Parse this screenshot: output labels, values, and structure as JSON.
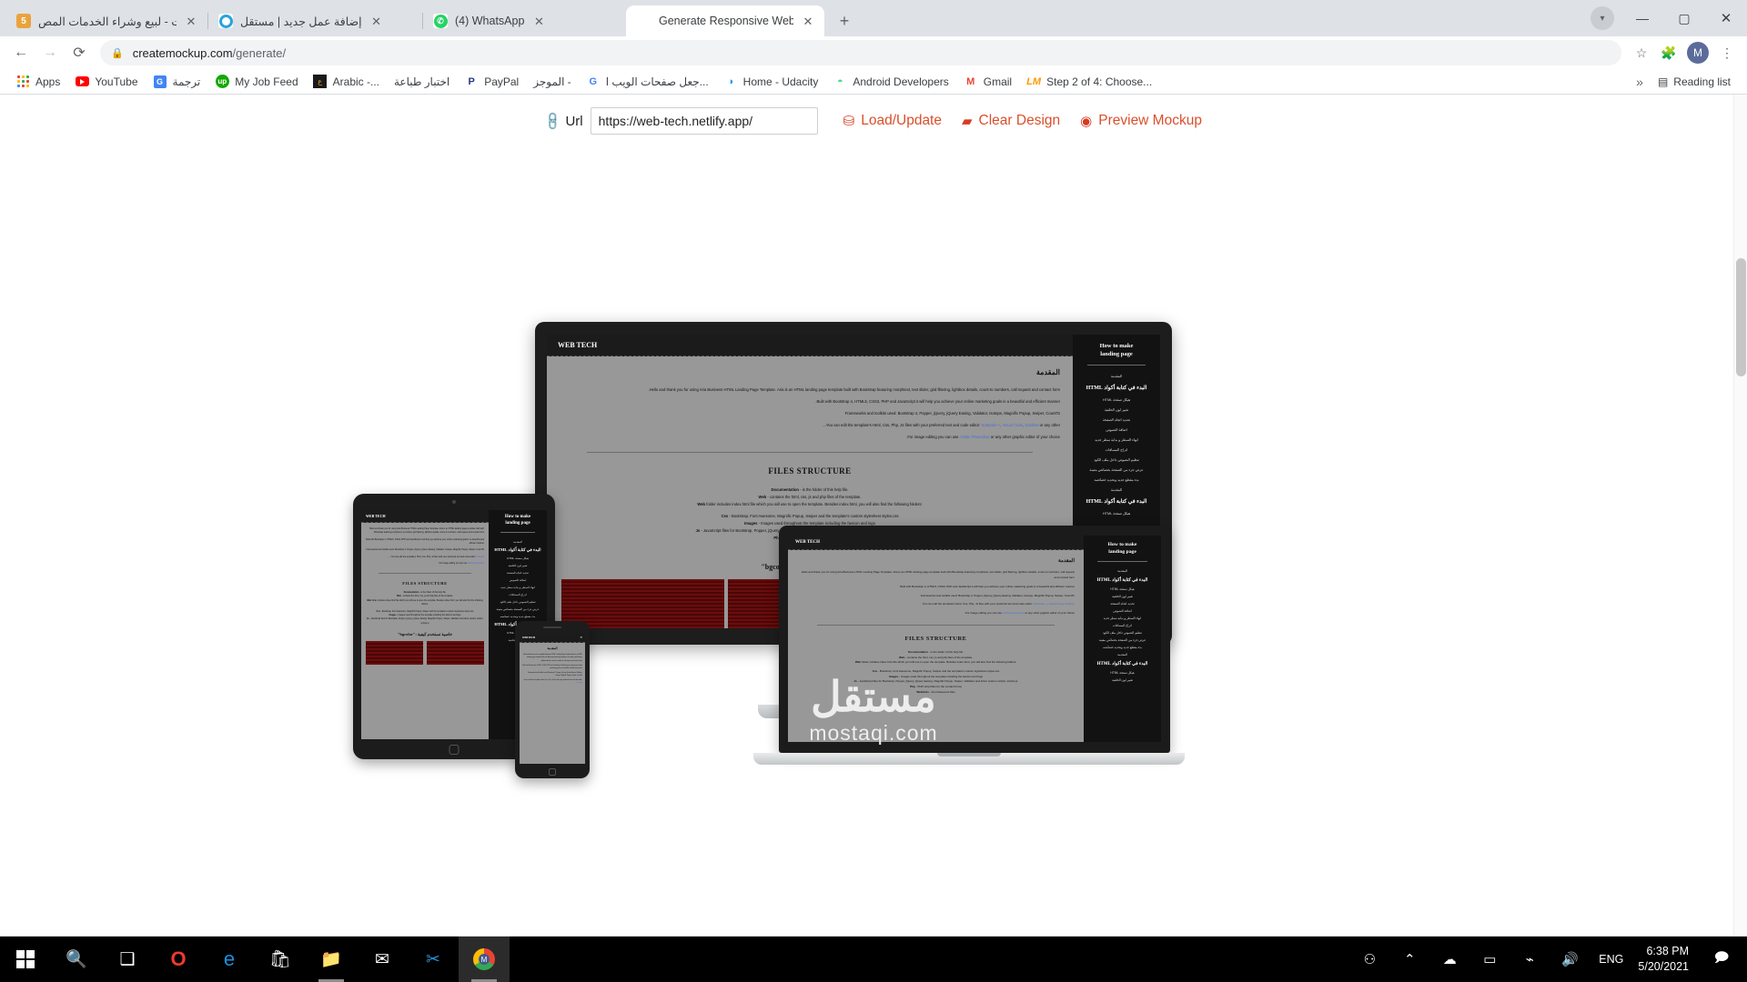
{
  "browser": {
    "tabs": [
      {
        "title": "خمسات - لبيع وشراء الخدمات المص",
        "favicon": "khamsat-icon",
        "active": false,
        "close": "✕"
      },
      {
        "title": "إضافة عمل جديد | مستقل",
        "favicon": "mostaqil-icon",
        "active": false,
        "close": "✕"
      },
      {
        "title": "(4) WhatsApp",
        "favicon": "whatsapp-icon",
        "active": false,
        "close": "✕"
      },
      {
        "title": "Generate Responsive Website Mo",
        "favicon": "laptop-icon",
        "active": true,
        "close": "✕"
      }
    ],
    "new_tab_label": "+",
    "window_controls": {
      "minimize": "—",
      "maximize": "▢",
      "close": "✕",
      "profile": "▾"
    },
    "nav": {
      "back": "←",
      "forward": "→",
      "reload": "⟳"
    },
    "omnibox": {
      "lock": "🔒",
      "url_bold": "createmockup.com",
      "url_dim": "/generate/",
      "star": "☆",
      "extensions": "🧩",
      "avatar_letter": "M",
      "menu": "⋮"
    },
    "bookmarks": [
      {
        "label": "Apps",
        "icon": "apps-grid-icon"
      },
      {
        "label": "YouTube",
        "icon": "youtube-icon"
      },
      {
        "label": "ترجمة",
        "icon": "google-translate-icon"
      },
      {
        "label": "My Job Feed",
        "icon": "upwork-icon"
      },
      {
        "label": "Arabic -...",
        "icon": "arabic-site-icon"
      },
      {
        "label": "اختبار طباعة",
        "icon": "print-test-icon"
      },
      {
        "label": "PayPal",
        "icon": "paypal-icon"
      },
      {
        "label": "الموجز -",
        "icon": "almojaz-icon"
      },
      {
        "label": "جعل صفحات الويب ا...",
        "icon": "google-icon"
      },
      {
        "label": "Home - Udacity",
        "icon": "udacity-icon"
      },
      {
        "label": "Android Developers",
        "icon": "android-icon"
      },
      {
        "label": "Gmail",
        "icon": "gmail-icon"
      },
      {
        "label": "Step 2 of 4: Choose...",
        "icon": "lm-icon"
      }
    ],
    "overflow_label": "»",
    "reading_list": {
      "label": "Reading list",
      "icon": "reading-list-icon"
    }
  },
  "app": {
    "url_label": "Url",
    "url_value": "https://web-tech.netlify.app/",
    "url_placeholder": "https://",
    "actions": [
      {
        "label": "Load/Update",
        "icon": "cloud-upload-icon",
        "color": "#d94f2b"
      },
      {
        "label": "Clear Design",
        "icon": "eraser-icon",
        "color": "#d94f2b"
      },
      {
        "label": "Preview Mockup",
        "icon": "eye-icon",
        "color": "#d94f2b"
      }
    ],
    "accent_color": "#d94f2b"
  },
  "mockup": {
    "site_title": "WEB TECH",
    "heading_intro": "المقدمة",
    "paragraphs": [
      "Hello and thank you for using Aria Business HTML Landing Page Template. Aria is an HTML landing page template built with Bootstrap featuring morphtext, text slider, grid filtering, lightbox details, count-to numbers, call request and contact form.",
      "Built with Bootstrap 4, HTML5, CSS3, PHP and JavaScript it will help you achieve your online marketing goals in a beautiful and efficient manner.",
      "Frameworks and toolkits used: Bootstrap 4, Popper, jQuery, jQuery Easing, Validator, Isotope, Magnific Popup, Swiper, CountTo",
      "You can edit the template's Html, Css, Php, Js files with your preferred text and code editor:",
      "For image editing you can use"
    ],
    "editor_links": [
      "Notepad++",
      "Visual Code",
      "Sublime"
    ],
    "editor_tail": "or any other...",
    "image_link": "Adobe Photoshop",
    "image_tail": "or any other graphic editor of your choice.",
    "files_heading": "FILES STRUCTURE",
    "files": [
      {
        "term": "Documentation",
        "desc": "- is the folder of this help file."
      },
      {
        "term": "Web",
        "desc": "- contains the html, css, js and php files of the template."
      },
      {
        "term": "Web",
        "desc": "folder includes index.html file which you will use to open the template. Besides index.html, you will also find the following folders:"
      },
      {
        "term": "Css",
        "desc": "- Bootstrap, Font Awesome, Magnific Popup, Swiper and the template's custom stylesheet styles.css"
      },
      {
        "term": "Images",
        "desc": "- Images used throughout the template including the favicon and logo"
      },
      {
        "term": "Js",
        "desc": "- JavaScript files for Bootstrap, Popper, jQuery, jQuery Easing, Magnific Popup, Swiper, Validator and Aria's custom scripts: scripts.js"
      },
      {
        "term": "Php",
        "desc": "- PHP script files for the contact forms"
      },
      {
        "term": "Webfonts",
        "desc": "- Font Awesome files"
      }
    ],
    "bgcolor_heading": "خاصية تستخدم كيفية :\"bgcolor\"",
    "sidebar": {
      "title_line1": "How to make",
      "title_line2": "landing page",
      "items": [
        {
          "label": "المقدمة",
          "highlight": false
        },
        {
          "label": "البدء في كتابة أكواد HTML",
          "highlight": true
        },
        {
          "label": "هيكل صفحة HTML",
          "highlight": false
        },
        {
          "label": "تغيير لون الخلفية",
          "highlight": false
        },
        {
          "label": "تحديد اتجاه الصفحة",
          "highlight": false
        },
        {
          "label": "اضافة النصوص",
          "highlight": false
        },
        {
          "label": "انهاء السطر و بداية سطر جديد",
          "highlight": false
        },
        {
          "label": "ادراج المسافات",
          "highlight": false
        },
        {
          "label": "تنظيم النصوص داخل ملف الكود",
          "highlight": false
        },
        {
          "label": "عرض جزء من الصفحة بخصائص معينة",
          "highlight": false
        },
        {
          "label": "بدء مقطع جديد وتحديد خصائصه",
          "highlight": false
        },
        {
          "label": "المقدمة",
          "highlight": false
        },
        {
          "label": "البدء في كتابة أكواد HTML",
          "highlight": true
        },
        {
          "label": "هيكل صفحة HTML",
          "highlight": false
        },
        {
          "label": "تغيير لون الخلفية",
          "highlight": false
        }
      ]
    }
  },
  "watermark": {
    "arabic": "مستقل",
    "latin": "mostaqi.com"
  },
  "taskbar": {
    "start_icon": "windows-logo-icon",
    "items": [
      {
        "icon": "search-icon",
        "name": "search"
      },
      {
        "icon": "task-view-icon",
        "name": "task-view"
      },
      {
        "icon": "opera-icon",
        "name": "opera"
      },
      {
        "icon": "edge-icon",
        "name": "edge"
      },
      {
        "icon": "microsoft-store-icon",
        "name": "store"
      },
      {
        "icon": "file-explorer-icon",
        "name": "file-explorer"
      },
      {
        "icon": "mail-icon",
        "name": "mail"
      },
      {
        "icon": "vscode-icon",
        "name": "vscode"
      },
      {
        "icon": "chrome-icon",
        "name": "chrome"
      }
    ],
    "tray": [
      {
        "icon": "people-icon",
        "name": "people"
      },
      {
        "icon": "chevron-up-icon",
        "name": "show-hidden-icons"
      },
      {
        "icon": "onedrive-icon",
        "name": "onedrive"
      },
      {
        "icon": "battery-icon",
        "name": "battery"
      },
      {
        "icon": "wifi-icon",
        "name": "wifi"
      },
      {
        "icon": "volume-icon",
        "name": "volume"
      }
    ],
    "language": "ENG",
    "time": "6:38 PM",
    "date": "5/20/2021",
    "notifications_icon": "notifications-icon"
  }
}
